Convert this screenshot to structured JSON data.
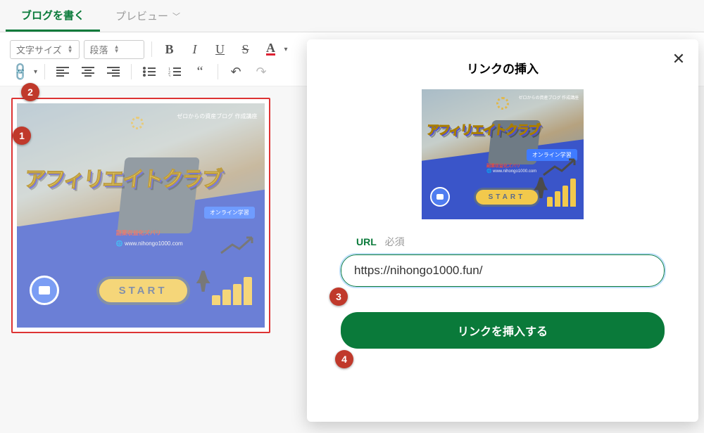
{
  "tabs": {
    "write": "ブログを書く",
    "preview": "プレビュー"
  },
  "toolbar": {
    "fontsize_label": "文字サイズ",
    "block_label": "段落"
  },
  "banner": {
    "tagline": "ゼロからの資産ブログ\n作成講座",
    "title": "アフィリエイトクラブ",
    "chip": "オンライン学習",
    "red1": "副業収益化ズバリ",
    "red2": "🌐 www.nihongo1000.com",
    "start": "START"
  },
  "modal": {
    "title": "リンクの挿入",
    "url_label": "URL",
    "required": "必須",
    "url_value": "https://nihongo1000.fun/",
    "insert_label": "リンクを挿入する"
  },
  "badges": {
    "b1": "1",
    "b2": "2",
    "b3": "3",
    "b4": "4"
  }
}
